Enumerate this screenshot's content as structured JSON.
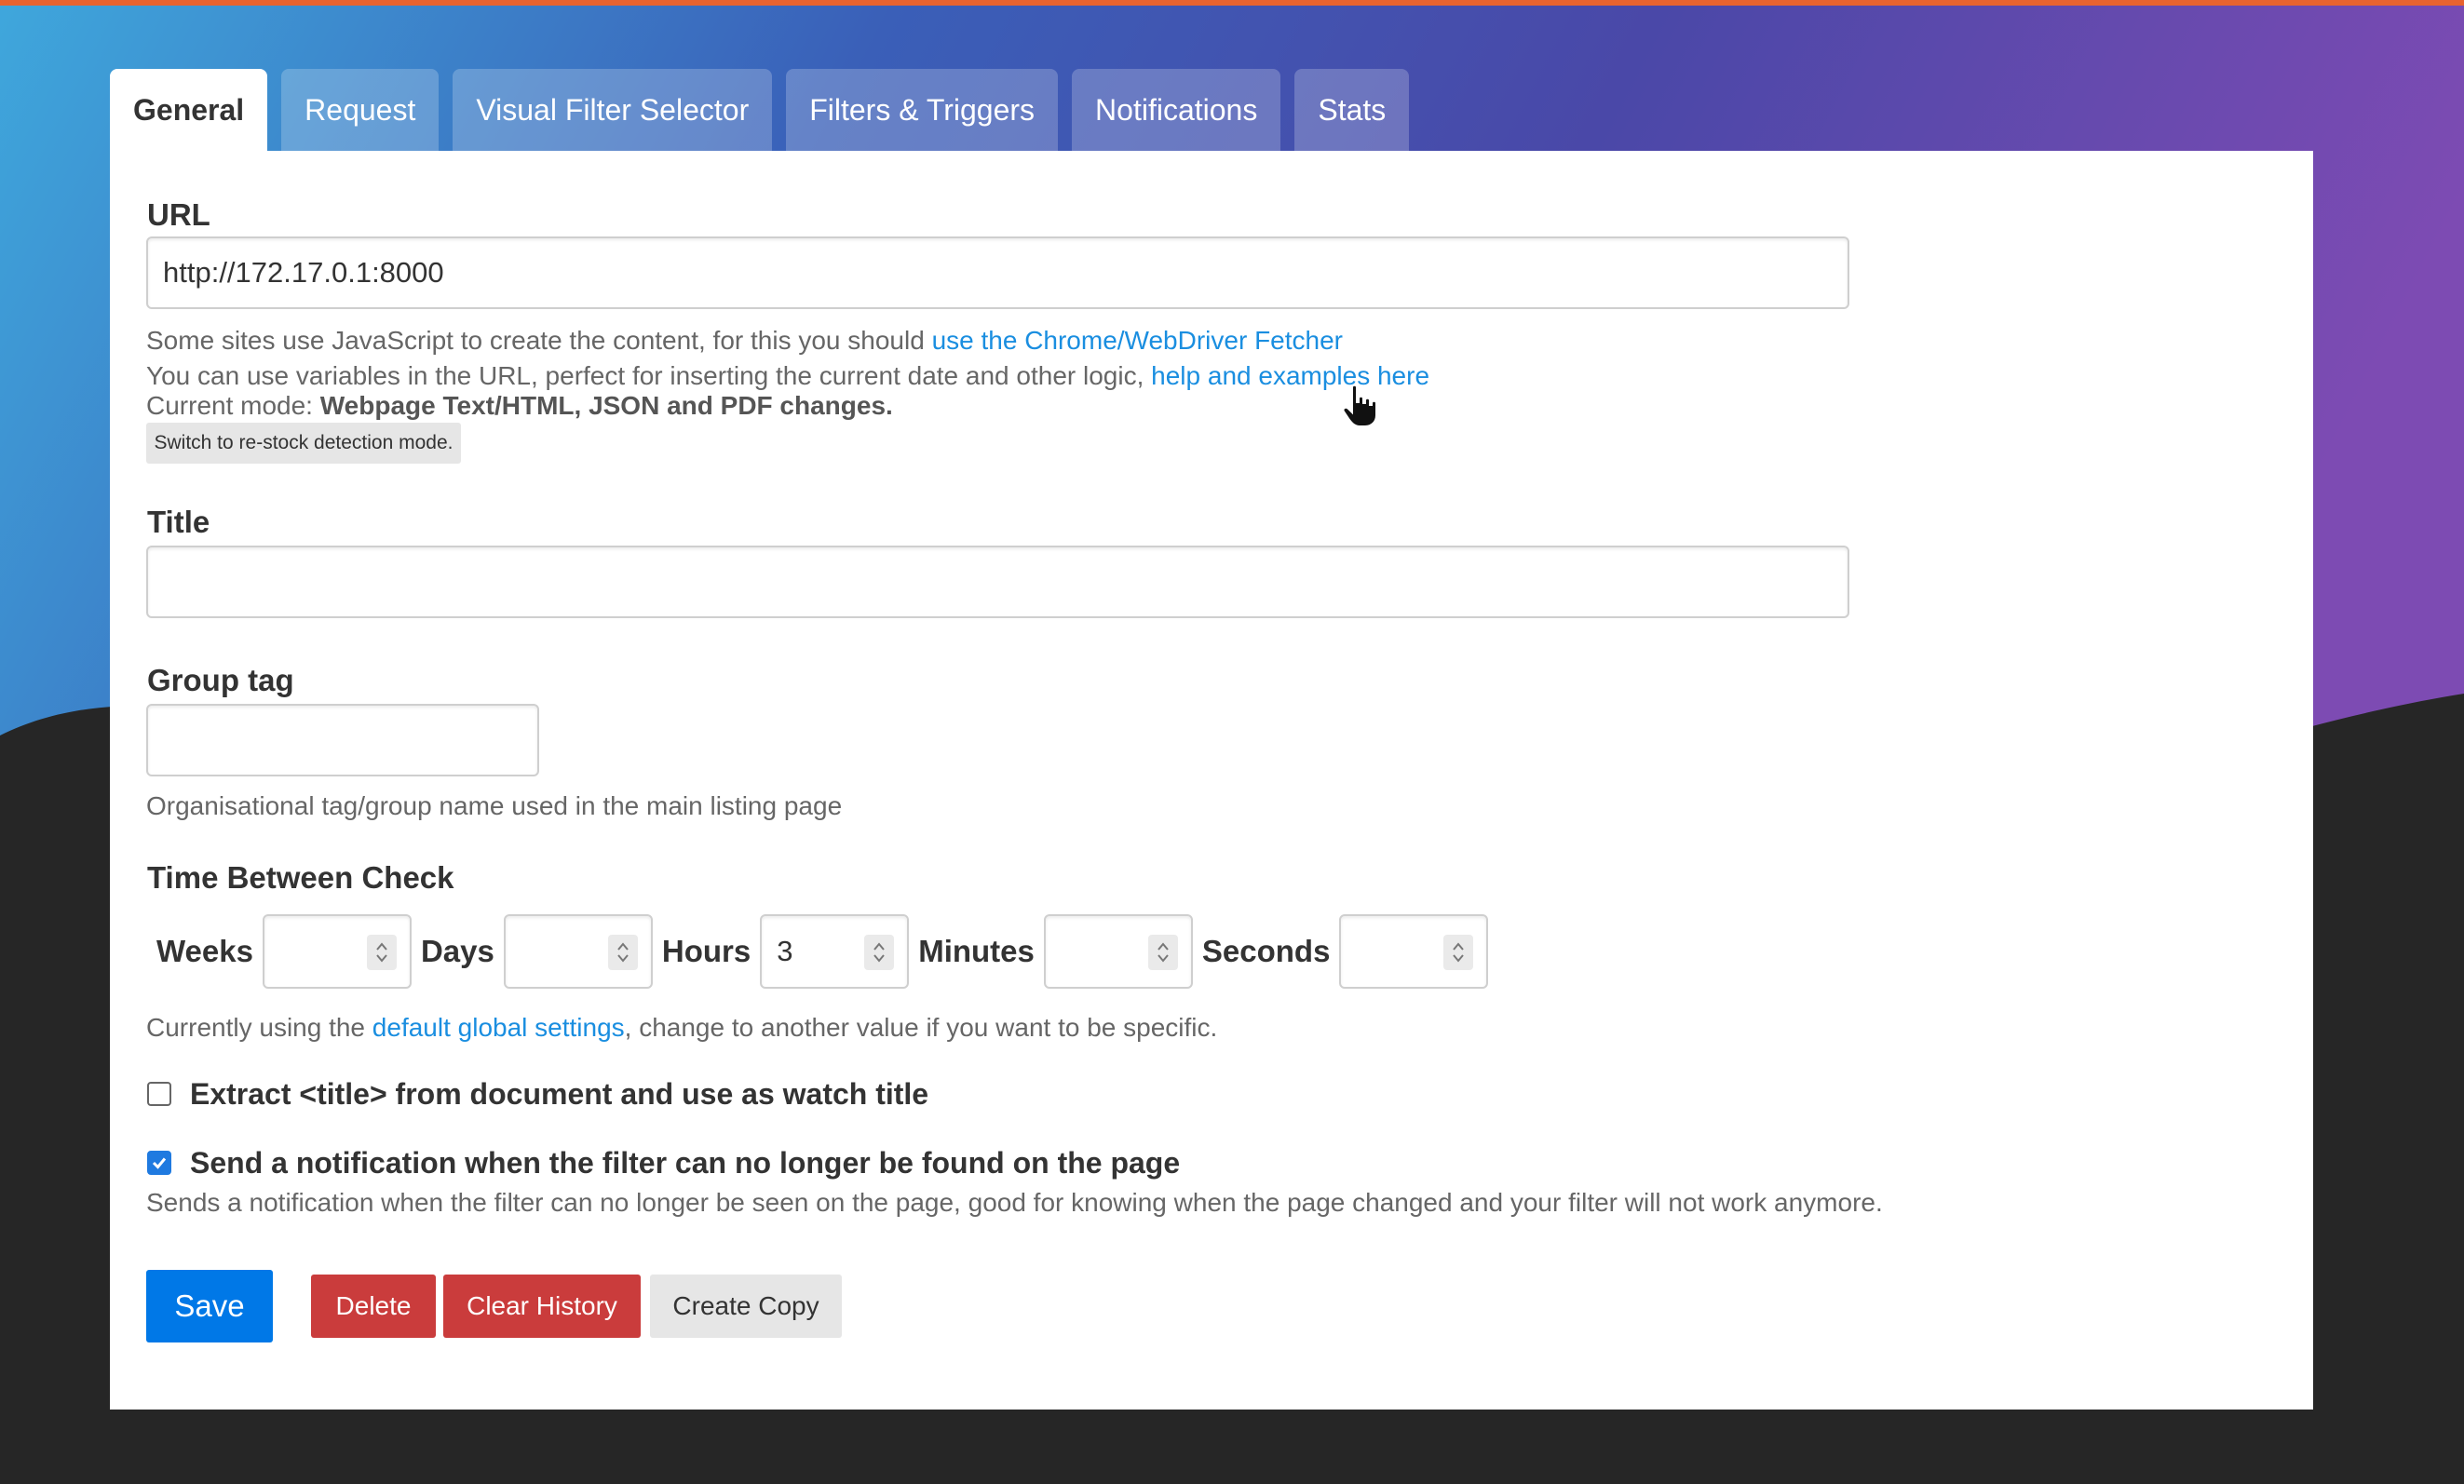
{
  "tabs": [
    {
      "label": "General",
      "active": true
    },
    {
      "label": "Request",
      "active": false
    },
    {
      "label": "Visual Filter Selector",
      "active": false
    },
    {
      "label": "Filters & Triggers",
      "active": false
    },
    {
      "label": "Notifications",
      "active": false
    },
    {
      "label": "Stats",
      "active": false
    }
  ],
  "url": {
    "label": "URL",
    "value": "http://172.17.0.1:8000",
    "help1_text": "Some sites use JavaScript to create the content, for this you should ",
    "help1_link": "use the Chrome/WebDriver Fetcher",
    "help2_text": "You can use variables in the URL, perfect for inserting the current date and other logic, ",
    "help2_link": "help and examples here",
    "mode_prefix": "Current mode: ",
    "mode_value": "Webpage Text/HTML, JSON and PDF changes.",
    "switch_button": "Switch to re-stock detection mode."
  },
  "title": {
    "label": "Title",
    "value": ""
  },
  "group_tag": {
    "label": "Group tag",
    "value": "",
    "help": "Organisational tag/group name used in the main listing page"
  },
  "time_between_check": {
    "label": "Time Between Check",
    "weeks_label": "Weeks",
    "weeks": "",
    "days_label": "Days",
    "days": "",
    "hours_label": "Hours",
    "hours": "3",
    "minutes_label": "Minutes",
    "minutes": "",
    "seconds_label": "Seconds",
    "seconds": "",
    "help_prefix": "Currently using the ",
    "help_link": "default global settings",
    "help_suffix": ", change to another value if you want to be specific."
  },
  "extract_title": {
    "label": "Extract <title> from document and use as watch title",
    "checked": false
  },
  "filter_notification": {
    "label": "Send a notification when the filter can no longer be found on the page",
    "checked": true,
    "help": "Sends a notification when the filter can no longer be seen on the page, good for knowing when the page changed and your filter will not work anymore."
  },
  "buttons": {
    "save": "Save",
    "delete": "Delete",
    "clear_history": "Clear History",
    "create_copy": "Create Copy"
  },
  "colors": {
    "accent_blue": "#0078e7",
    "danger_red": "#ca3c3c",
    "link_blue": "#1a8ee0",
    "gradient_left": "#3fa7dc",
    "gradient_right": "#7d4bb3"
  }
}
